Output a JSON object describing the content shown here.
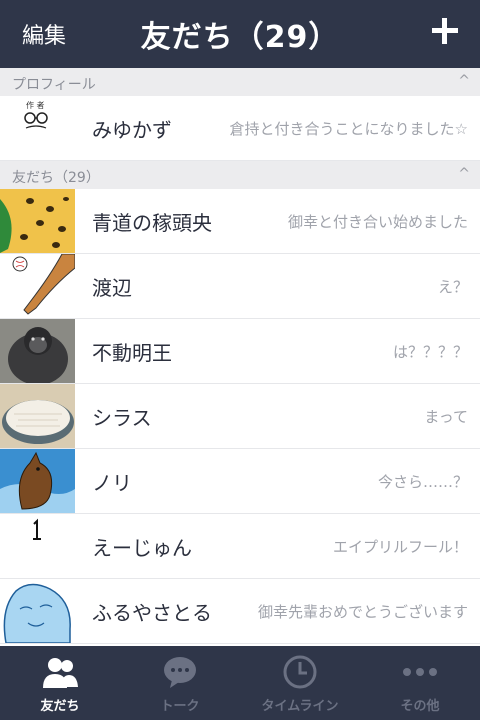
{
  "header": {
    "edit_label": "編集",
    "title": "友だち（29）"
  },
  "profile_section": {
    "label": "プロフィール",
    "caret": "^"
  },
  "profile": {
    "name": "みゆかず",
    "status": "倉持と付き合うことになりました☆"
  },
  "friends_section": {
    "label": "友だち（29）",
    "caret": "^"
  },
  "friends": [
    {
      "name": "青道の稼頭央",
      "status": "御幸と付き合い始めました"
    },
    {
      "name": "渡辺",
      "status": "え？"
    },
    {
      "name": "不動明王",
      "status": "は？？？？"
    },
    {
      "name": "シラス",
      "status": "まって"
    },
    {
      "name": "ノリ",
      "status": "今さら……？"
    },
    {
      "name": "えーじゅん",
      "status": "エイプリルフール！"
    },
    {
      "name": "ふるやさとる",
      "status": "御幸先輩おめでとうございます"
    }
  ],
  "tabs": [
    {
      "label": "友だち",
      "icon": "friends-icon",
      "active": true
    },
    {
      "label": "トーク",
      "icon": "chat-icon",
      "active": false
    },
    {
      "label": "タイムライン",
      "icon": "timeline-icon",
      "active": false
    },
    {
      "label": "その他",
      "icon": "more-icon",
      "active": false
    }
  ],
  "colors": {
    "header_bg": "#2f3649",
    "section_bg": "#ececee",
    "tab_inactive": "#6b7183"
  }
}
